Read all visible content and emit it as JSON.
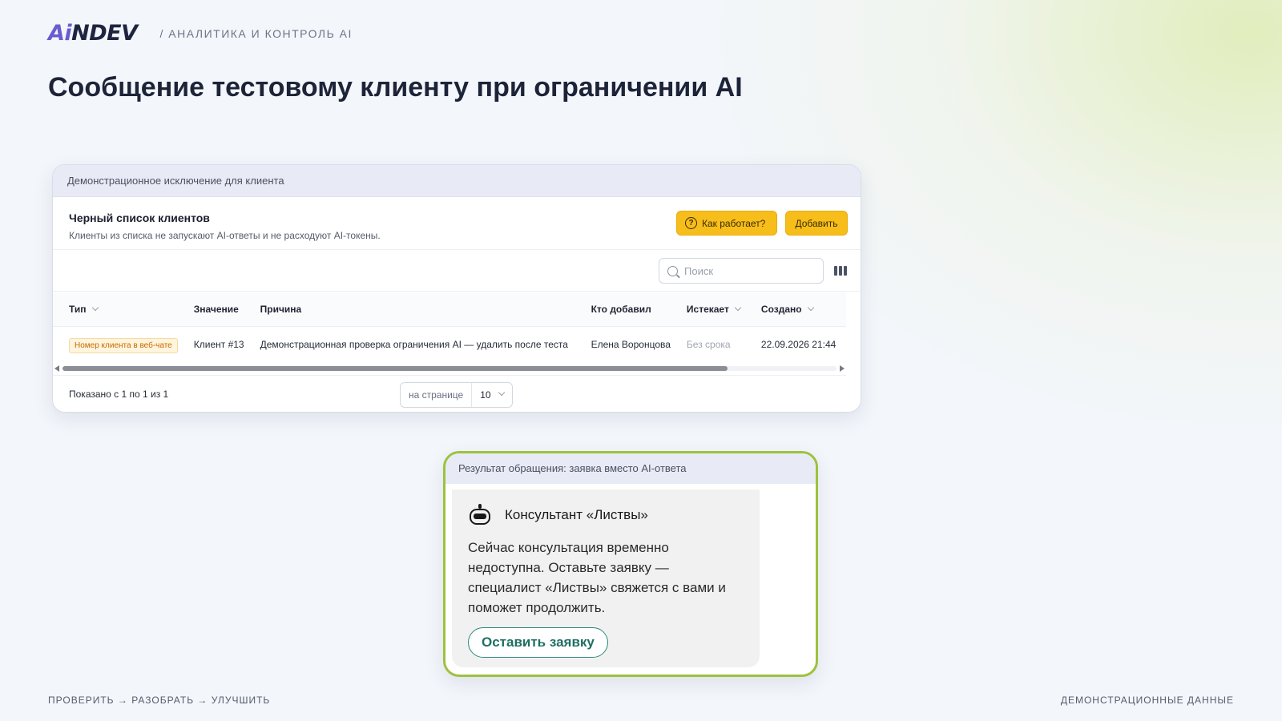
{
  "header": {
    "logo_ai": "Ai",
    "logo_ndev": "NDEV",
    "breadcrumb": "/ АНАЛИТИКА И КОНТРОЛЬ AI"
  },
  "page_title": "Сообщение тестовому клиенту при ограничении AI",
  "blacklist_card": {
    "caption": "Демонстрационное исключение для клиента",
    "title": "Черный список клиентов",
    "subtitle": "Клиенты из списка не запускают AI-ответы и не расходуют AI-токены.",
    "how_button": "Как работает?",
    "add_button": "Добавить",
    "search_placeholder": "Поиск",
    "columns": {
      "type": "Тип",
      "value": "Значение",
      "reason": "Причина",
      "added_by": "Кто добавил",
      "expires": "Истекает",
      "created": "Создано"
    },
    "rows": [
      {
        "type": "Номер клиента в веб-чате",
        "value": "Клиент #13",
        "reason": "Демонстрационная проверка ограничения AI — удалить после теста",
        "added_by": "Елена Воронцова",
        "expires": "Без срока",
        "created": "22.09.2026 21:44"
      }
    ],
    "shown_text": "Показано с 1 по 1 из 1",
    "per_page_label": "на странице",
    "per_page_value": "10"
  },
  "result_card": {
    "caption": "Результат обращения: заявка вместо AI-ответа",
    "bot_name": "Консультант «Листвы»",
    "message": "Сейчас консультация временно недоступна. Оставьте заявку — специалист «Листвы» свяжется с вами и поможет продолжить.",
    "button": "Оставить заявку"
  },
  "footer": {
    "left": "ПРОВЕРИТЬ → РАЗОБРАТЬ → УЛУЧШИТЬ",
    "right": "ДЕМОНСТРАЦИОННЫЕ ДАННЫЕ"
  },
  "colors": {
    "accent_yellow": "#f7bd1a",
    "accent_green_border": "#9cc23e",
    "request_button": "#2b8a7a",
    "logo_ai": "#6a5bd0"
  }
}
